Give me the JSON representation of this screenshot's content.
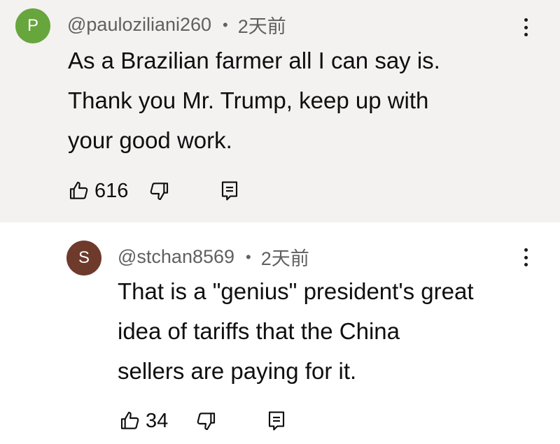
{
  "comments": [
    {
      "avatar_letter": "P",
      "avatar_color": "#67a53d",
      "username": "@pauloziliani260",
      "separator": "•",
      "time": "2天前",
      "lines": [
        "As a Brazilian farmer all I can say is.",
        "Thank you Mr. Trump, keep up with",
        "your good work."
      ],
      "likes": "616",
      "background": "#f4f1f1"
    },
    {
      "avatar_letter": "S",
      "avatar_color": "#6d3a2c",
      "username": "@stchan8569",
      "separator": "•",
      "time": "2天前",
      "lines": [
        "That is a \"genius\" president's great",
        "idea of tariffs that the China",
        "sellers are paying for it."
      ],
      "likes": "34",
      "background": "#ffffff"
    }
  ],
  "icons": {
    "like": "thumbs-up-icon",
    "dislike": "thumbs-down-icon",
    "reply": "reply-comment-icon",
    "more": "more-vertical-icon"
  }
}
